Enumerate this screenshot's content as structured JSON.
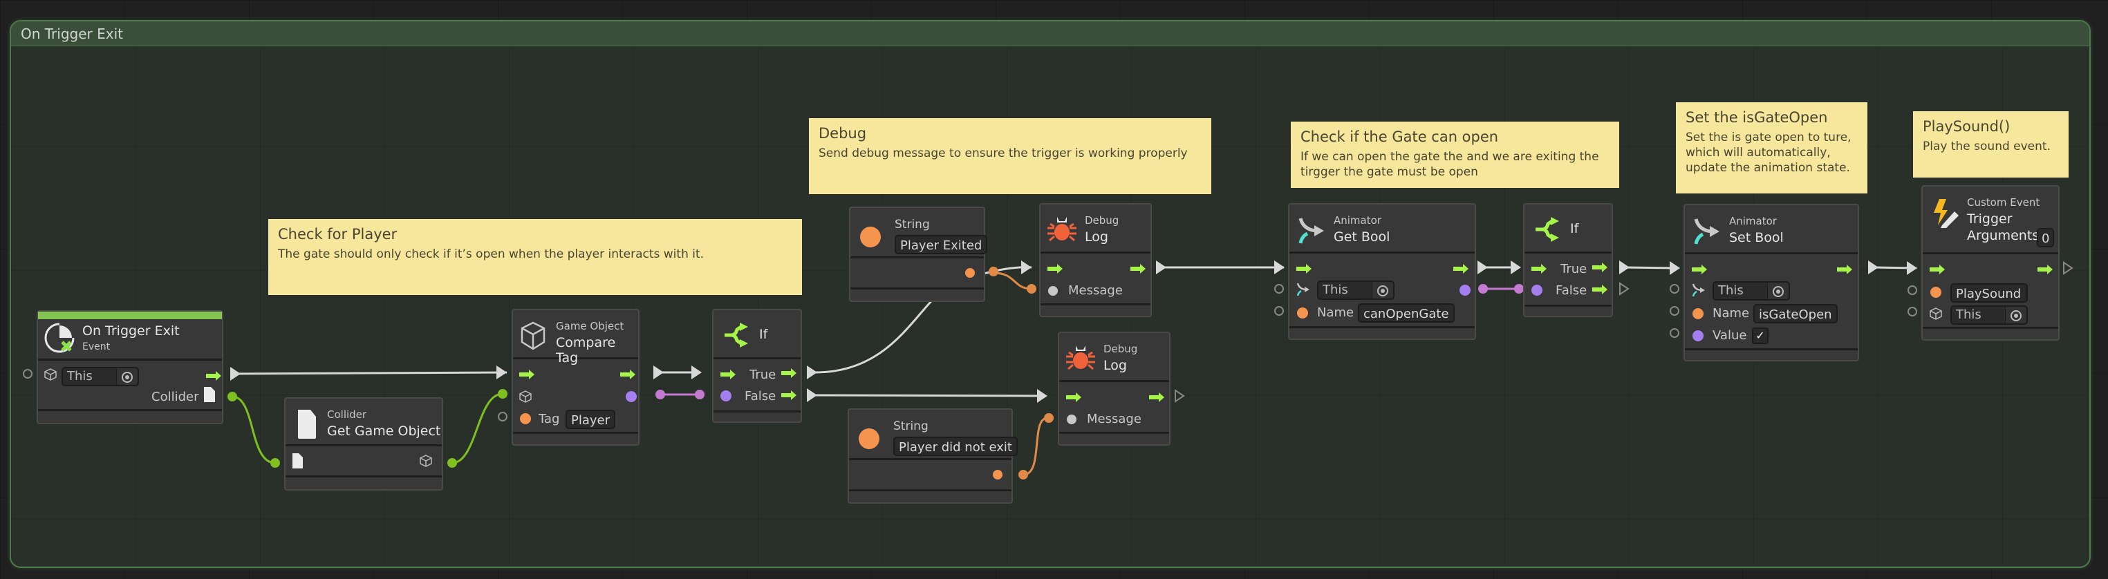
{
  "group": {
    "title": "On Trigger Exit"
  },
  "comments": [
    {
      "title": "Check for Player",
      "body": "The gate should only check if it’s open when the player interacts with it."
    },
    {
      "title": "Debug",
      "body": "Send debug message to ensure the trigger is working properly"
    },
    {
      "title": "Check if the Gate can open",
      "body": "If we can open the gate the and we are exiting the tirgger the gate must be open"
    },
    {
      "title": "Set the isGateOpen",
      "body": "Set the is gate open to ture, which will automatically, update the animation state."
    },
    {
      "title": "PlaySound()",
      "body": "Play the sound event."
    }
  ],
  "nodes": {
    "on_trigger_exit": {
      "title": "On Trigger Exit",
      "subtitle": "Event",
      "target_value": "This",
      "output_label": "Collider",
      "icon": "trigger-exit-icon"
    },
    "get_game_object": {
      "category": "Collider",
      "title": "Get Game Object",
      "icon": "collider-file-icon"
    },
    "compare_tag": {
      "category": "Game Object",
      "title": "Compare Tag",
      "tag_label": "Tag",
      "tag_value": "Player",
      "icon": "cube-icon"
    },
    "if_1": {
      "title": "If",
      "true_label": "True",
      "false_label": "False",
      "icon": "branch-icon"
    },
    "string_1": {
      "category": "String",
      "value": "Player Exited",
      "icon": "string-dot-icon"
    },
    "string_2": {
      "category": "String",
      "value": "Player did not exit",
      "icon": "string-dot-icon"
    },
    "debug_log_1": {
      "category": "Debug",
      "title": "Log",
      "message_label": "Message",
      "icon": "bug-icon"
    },
    "debug_log_2": {
      "category": "Debug",
      "title": "Log",
      "message_label": "Message",
      "icon": "bug-icon"
    },
    "get_bool": {
      "category": "Animator",
      "title": "Get Bool",
      "target_value": "This",
      "name_label": "Name",
      "name_value": "canOpenGate",
      "icon": "animator-icon"
    },
    "if_2": {
      "title": "If",
      "true_label": "True",
      "false_label": "False",
      "icon": "branch-icon"
    },
    "set_bool": {
      "category": "Animator",
      "title": "Set Bool",
      "target_value": "This",
      "name_label": "Name",
      "name_value": "isGateOpen",
      "value_label": "Value",
      "value_checked": "✓",
      "icon": "animator-icon"
    },
    "custom_event": {
      "category": "Custom Event",
      "title": "Trigger",
      "args_label": "Arguments",
      "args_value": "0",
      "event_name": "PlaySound",
      "target_value": "This",
      "icon": "lightning-pencil-icon"
    }
  },
  "colors": {
    "control_flow": "#a6f34a",
    "boolean_port": "#a47ff0",
    "string_port": "#f5944e",
    "object_wire": "#7fbf1f",
    "comment_bg": "#f6e79c",
    "group_border": "#4c7a4c",
    "event_bar": "#84c451"
  }
}
